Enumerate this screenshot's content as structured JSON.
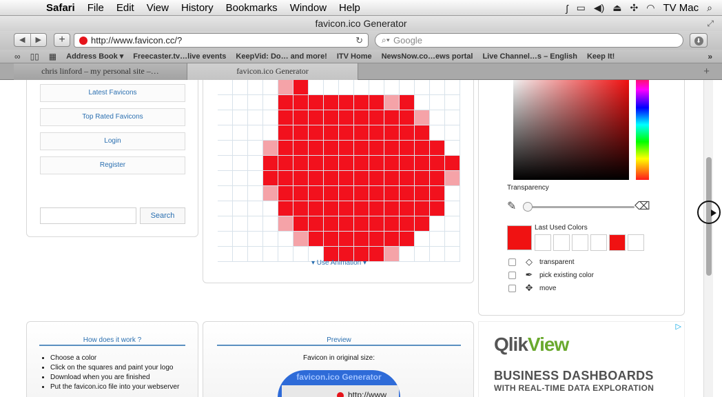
{
  "menubar": {
    "app": "Safari",
    "items": [
      "File",
      "Edit",
      "View",
      "History",
      "Bookmarks",
      "Window",
      "Help"
    ],
    "user": "TV Mac"
  },
  "window": {
    "title": "favicon.ico Generator"
  },
  "toolbar": {
    "url": "http://www.favicon.cc/?",
    "search_placeholder": "Google"
  },
  "bookmarks": [
    "Address Book ▾",
    "Freecaster.tv…live events",
    "KeepVid: Do… and more!",
    "ITV Home",
    "NewsNow.co…ews portal",
    "Live Channel…s – English",
    "Keep It!"
  ],
  "tabs": [
    "chris linford – my personal site –…",
    "favicon.ico Generator"
  ],
  "sidebar": {
    "links": [
      "Latest Favicons",
      "Top Rated Favicons",
      "Login",
      "Register"
    ],
    "search_button": "Search"
  },
  "editor": {
    "use_animation": "▾ Use Animation ▾",
    "grid": [
      "0000210000000000",
      "0000111111121000",
      "0000111111111200",
      "0000111111111100",
      "0002111111111110",
      "0001111111111111",
      "0001111111111112",
      "0002111111111110",
      "0000111111111110",
      "0000211111111100",
      "0000021111111000",
      "0000000111120000"
    ],
    "colors": {
      "paint": "#f2111d",
      "light": "#f5a3a8"
    }
  },
  "color_panel": {
    "transparency_label": "Transparency",
    "transparency": 0,
    "last_used_label": "Last Used Colors",
    "current_color": "#f01212",
    "last_used": [
      "#ffffff",
      "#ffffff",
      "#ffffff",
      "#ffffff",
      "#f01212",
      "#ffffff"
    ],
    "options": [
      "transparent",
      "pick existing color",
      "move"
    ]
  },
  "howto": {
    "title": "How does it work ?",
    "steps": [
      "Choose a color",
      "Click on the squares and paint your logo",
      "Download when you are finished",
      "Put the favicon.ico file into your webserver"
    ]
  },
  "preview": {
    "title": "Preview",
    "original_label": "Favicon in original size:",
    "image_title": "favicon.ico Generator",
    "image_url": "http://www"
  },
  "ad": {
    "brand_a": "Qlik",
    "brand_b": "View",
    "headline": "BUSINESS DASHBOARDS",
    "subline": "WITH REAL-TIME DATA EXPLORATION"
  }
}
